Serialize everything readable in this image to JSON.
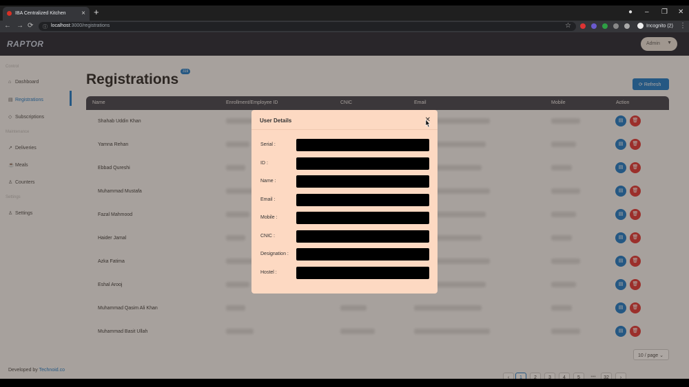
{
  "browser": {
    "tab_title": "IBA Centralized Kitchen",
    "url_host": "localhost",
    "url_path": ":3000/registrations",
    "incognito_label": "Incognito (2)"
  },
  "app": {
    "logo": "RAPTOR",
    "user_menu": "Admin",
    "developed_by_prefix": "Developed by",
    "developed_by_name": "Technoid.co"
  },
  "sidebar": {
    "sections": [
      {
        "title": "Control",
        "items": [
          {
            "label": "Dashboard",
            "icon": "home-icon"
          },
          {
            "label": "Registrations",
            "icon": "id-card-icon",
            "active": true
          },
          {
            "label": "Subscriptions",
            "icon": "tag-icon"
          }
        ]
      },
      {
        "title": "Maintenance",
        "items": [
          {
            "label": "Deliveries",
            "icon": "truck-icon"
          },
          {
            "label": "Meals",
            "icon": "meal-icon"
          },
          {
            "label": "Counters",
            "icon": "user-icon"
          }
        ]
      },
      {
        "title": "Settings",
        "items": [
          {
            "label": "Settings",
            "icon": "user-icon"
          }
        ]
      }
    ]
  },
  "page": {
    "title": "Registrations",
    "count_badge": "319",
    "refresh_label": "Refresh"
  },
  "table": {
    "columns": [
      "Name",
      "Enrollment/Employee ID",
      "CNIC",
      "Email",
      "Mobile",
      "Action"
    ],
    "rows": [
      "Shahab Uddin Khan",
      "Yamna Rehan",
      "Ebbad Qureshi",
      "Muhammad Mustafa",
      "Fazal Mahmood",
      "Haider Jamal",
      "Azka Fatima",
      "Eshal Arooj",
      "Muhammad Qasim Ali Khan",
      "Muhammad Basit Ullah"
    ]
  },
  "pagination": {
    "pages": [
      "1",
      "2",
      "3",
      "4",
      "5",
      "•••",
      "32"
    ],
    "current": "1",
    "page_size": "10 / page"
  },
  "modal": {
    "title": "User Details",
    "fields": [
      "Serial :",
      "ID :",
      "Name :",
      "Email :",
      "Mobile :",
      "CNIC :",
      "Designation :",
      "Hostel :"
    ]
  },
  "colors": {
    "primary": "#1677c8",
    "danger": "#e03131",
    "header": "#1c2230",
    "modal_bg": "#fdd9c2"
  }
}
